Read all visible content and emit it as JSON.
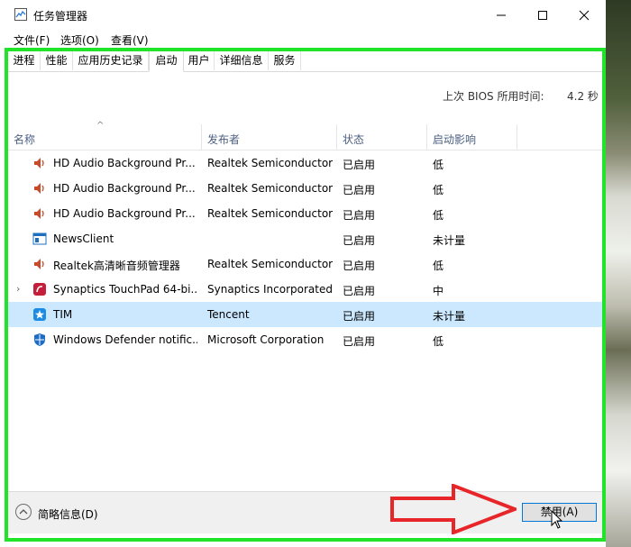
{
  "window": {
    "title": "任务管理器"
  },
  "menu": [
    "文件(F)",
    "选项(O)",
    "查看(V)"
  ],
  "tabs": [
    "进程",
    "性能",
    "应用历史记录",
    "启动",
    "用户",
    "详细信息",
    "服务"
  ],
  "active_tab": "启动",
  "bios": {
    "label": "上次 BIOS 所用时间:",
    "value": "4.2 秒"
  },
  "columns": [
    "名称",
    "发布者",
    "状态",
    "启动影响"
  ],
  "rows": [
    {
      "name": "HD Audio Background Pr...",
      "publisher": "Realtek Semiconductor",
      "status": "已启用",
      "impact": "低",
      "icon": "speaker-icon"
    },
    {
      "name": "HD Audio Background Pr...",
      "publisher": "Realtek Semiconductor",
      "status": "已启用",
      "impact": "低",
      "icon": "speaker-icon"
    },
    {
      "name": "HD Audio Background Pr...",
      "publisher": "Realtek Semiconductor",
      "status": "已启用",
      "impact": "低",
      "icon": "speaker-icon"
    },
    {
      "name": "NewsClient",
      "publisher": "",
      "status": "已启用",
      "impact": "未计量",
      "icon": "window-app-icon"
    },
    {
      "name": "Realtek高清晰音频管理器",
      "publisher": "Realtek Semiconductor",
      "status": "已启用",
      "impact": "低",
      "icon": "speaker-icon"
    },
    {
      "name": "Synaptics TouchPad 64-bi...",
      "publisher": "Synaptics Incorporated",
      "status": "已启用",
      "impact": "中",
      "icon": "synaptics-icon"
    },
    {
      "name": "TIM",
      "publisher": "Tencent",
      "status": "已启用",
      "impact": "未计量",
      "icon": "tim-icon"
    },
    {
      "name": "Windows Defender notific...",
      "publisher": "Microsoft Corporation",
      "status": "已启用",
      "impact": "低",
      "icon": "defender-shield-icon"
    }
  ],
  "footer": {
    "fewer_details": "简略信息(D)",
    "disable_button": "禁用(A)"
  },
  "colors": {
    "highlight_frame": "#21e32a",
    "annotation_arrow": "#e8262a",
    "selected_row": "#cce8ff"
  }
}
